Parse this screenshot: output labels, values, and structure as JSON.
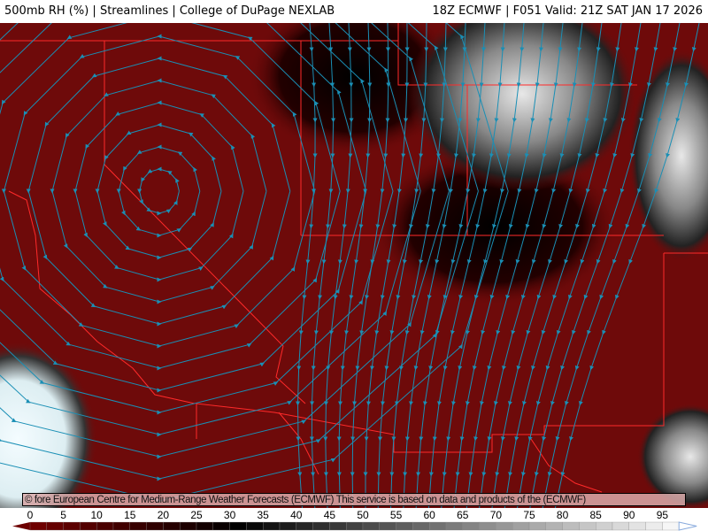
{
  "header": {
    "title_left": "500mb RH (%) | Streamlines | College of DuPage NEXLAB",
    "title_right": "18Z ECMWF | F051 Valid: 21Z SAT JAN 17 2026"
  },
  "attribution": "© fore European Centre for Medium-Range Weather Forecasts (ECMWF)  This service is based on data and products of the (ECMWF)",
  "colorbar": {
    "ticks": [
      "0",
      "5",
      "10",
      "15",
      "20",
      "25",
      "30",
      "35",
      "40",
      "45",
      "50",
      "55",
      "60",
      "65",
      "70",
      "75",
      "80",
      "85",
      "90",
      "95"
    ],
    "min_color": "#6a0000",
    "mid_color": "#000000",
    "max_color": "#ffffff",
    "extend": "both"
  },
  "map": {
    "field": "500mb relative humidity",
    "streamline_color": "#1a8fb5",
    "border_color": "#ff2020",
    "dry_color": "#6e0a0a"
  }
}
